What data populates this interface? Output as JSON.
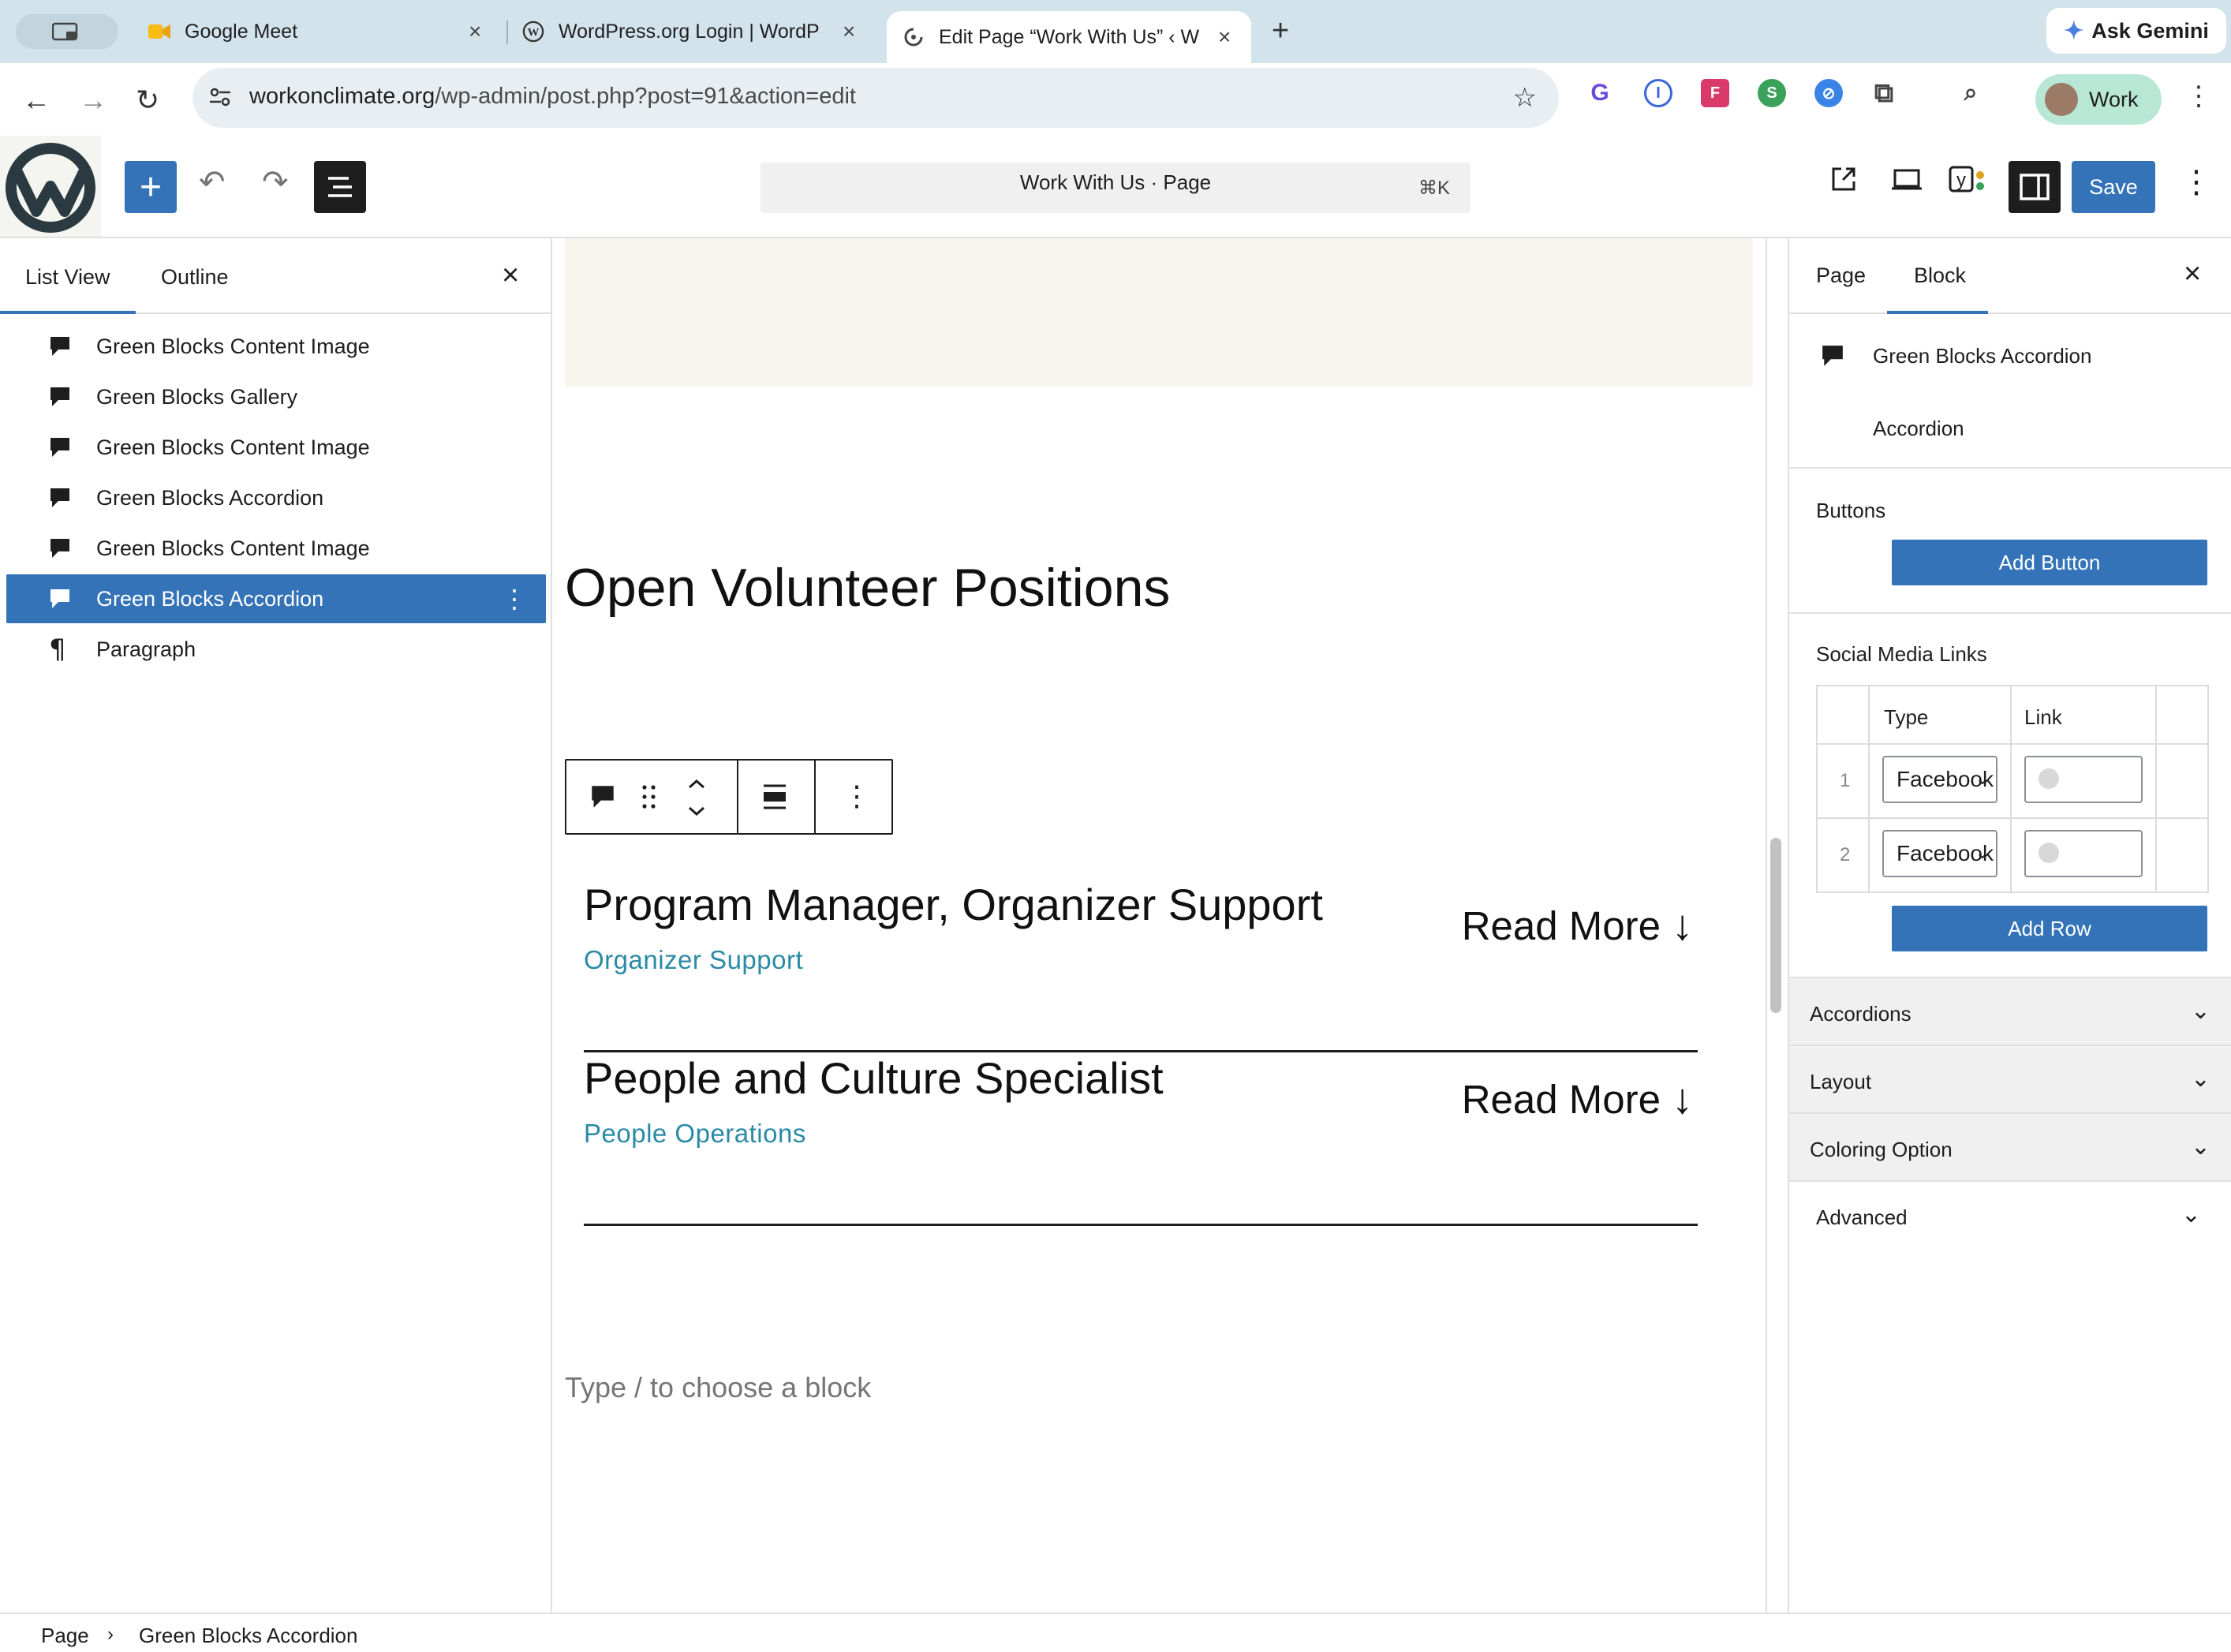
{
  "browser": {
    "tabs": [
      {
        "title": "Google Meet"
      },
      {
        "title": "WordPress.org Login | WordP"
      },
      {
        "title": "Edit Page “Work With Us” ‹ W"
      }
    ],
    "ask_gemini": "Ask Gemini",
    "url_host": "workonclimate.org",
    "url_path": "/wp-admin/post.php?post=91&action=edit",
    "profile_label": "Work"
  },
  "editor": {
    "document_title": "Work With Us · Page",
    "shortcut": "⌘K",
    "save_label": "Save"
  },
  "list_view": {
    "tabs": [
      "List View",
      "Outline"
    ],
    "items": [
      {
        "label": "Green Blocks Content Image",
        "icon": "block-comment-icon",
        "selected": false
      },
      {
        "label": "Green Blocks Gallery",
        "icon": "block-comment-icon",
        "selected": false
      },
      {
        "label": "Green Blocks Content Image",
        "icon": "block-comment-icon",
        "selected": false
      },
      {
        "label": "Green Blocks Accordion",
        "icon": "block-comment-icon",
        "selected": false
      },
      {
        "label": "Green Blocks Content Image",
        "icon": "block-comment-icon",
        "selected": false
      },
      {
        "label": "Green Blocks Accordion",
        "icon": "block-comment-icon",
        "selected": true
      },
      {
        "label": "Paragraph",
        "icon": "paragraph-icon",
        "selected": false
      }
    ]
  },
  "canvas": {
    "heading": "Open Volunteer Positions",
    "accordions": [
      {
        "title": "Program Manager, Organizer Support",
        "subtitle": "Organizer Support",
        "action": "Read More"
      },
      {
        "title": "People and Culture Specialist",
        "subtitle": "People Operations",
        "action": "Read More"
      }
    ],
    "placeholder": "Type / to choose a block"
  },
  "settings": {
    "tabs": [
      "Page",
      "Block"
    ],
    "block_name": "Green Blocks Accordion",
    "block_description": "Accordion",
    "buttons_label": "Buttons",
    "add_button": "Add Button",
    "social_label": "Social Media Links",
    "table_headers": [
      "Type",
      "Link"
    ],
    "rows": [
      {
        "num": "1",
        "type": "Facebook"
      },
      {
        "num": "2",
        "type": "Facebook"
      }
    ],
    "add_row": "Add Row",
    "sections": [
      "Accordions",
      "Layout",
      "Coloring Option",
      "Advanced"
    ]
  },
  "breadcrumb": [
    "Page",
    "Green Blocks Accordion"
  ],
  "colors": {
    "accent": "#3473b7",
    "subtitle": "#2b8aa6"
  }
}
